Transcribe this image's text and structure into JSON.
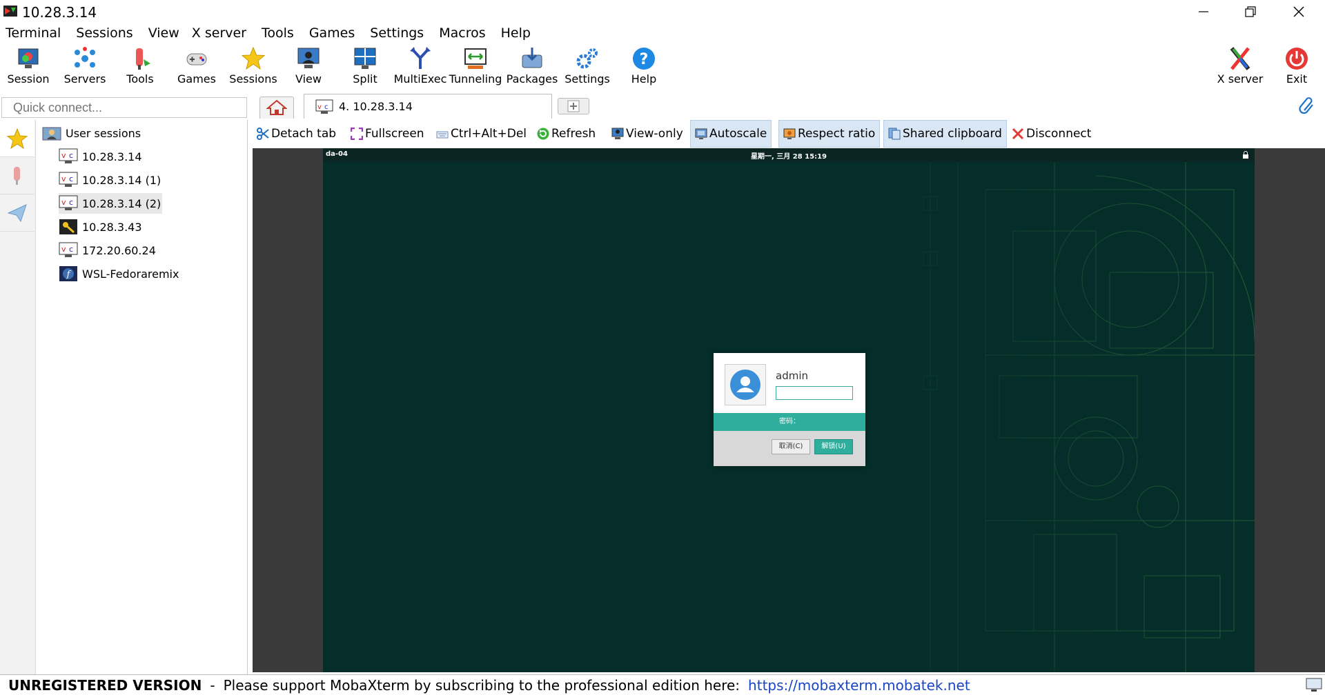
{
  "window": {
    "title": "10.28.3.14"
  },
  "menu": [
    "Terminal",
    "Sessions",
    "View",
    "X server",
    "Tools",
    "Games",
    "Settings",
    "Macros",
    "Help"
  ],
  "toolbar": {
    "left": [
      {
        "label": "Session",
        "icon": "session-icon"
      },
      {
        "label": "Servers",
        "icon": "servers-icon"
      },
      {
        "label": "Tools",
        "icon": "tools-icon"
      },
      {
        "label": "Games",
        "icon": "games-icon"
      },
      {
        "label": "Sessions",
        "icon": "star-icon"
      },
      {
        "label": "View",
        "icon": "view-icon"
      },
      {
        "label": "Split",
        "icon": "split-icon"
      },
      {
        "label": "MultiExec",
        "icon": "multiexec-icon"
      },
      {
        "label": "Tunneling",
        "icon": "tunneling-icon"
      },
      {
        "label": "Packages",
        "icon": "packages-icon"
      },
      {
        "label": "Settings",
        "icon": "settings-icon"
      },
      {
        "label": "Help",
        "icon": "help-icon"
      }
    ],
    "right": [
      {
        "label": "X server",
        "icon": "x-server-icon"
      },
      {
        "label": "Exit",
        "icon": "exit-icon"
      }
    ]
  },
  "quick_connect": {
    "placeholder": "Quick connect..."
  },
  "tabs": {
    "active_label": "4. 10.28.3.14"
  },
  "sessions": {
    "root": "User sessions",
    "items": [
      {
        "label": "10.28.3.14",
        "type": "vnc"
      },
      {
        "label": "10.28.3.14 (1)",
        "type": "vnc"
      },
      {
        "label": "10.28.3.14 (2)",
        "type": "vnc",
        "selected": true
      },
      {
        "label": "10.28.3.43",
        "type": "ssh"
      },
      {
        "label": "172.20.60.24",
        "type": "vnc"
      },
      {
        "label": "WSL-Fedoraremix",
        "type": "wsl"
      }
    ]
  },
  "vnc_toolbar": [
    {
      "label": "Detach tab",
      "icon": "scissors-icon"
    },
    {
      "label": "Fullscreen",
      "icon": "fullscreen-icon"
    },
    {
      "label": "Ctrl+Alt+Del",
      "icon": "keyboard-icon"
    },
    {
      "label": "Refresh",
      "icon": "refresh-icon"
    },
    {
      "label": "View-only",
      "icon": "view-only-icon"
    },
    {
      "label": "Autoscale",
      "icon": "autoscale-icon",
      "active": true
    },
    {
      "label": "Respect ratio",
      "icon": "ratio-icon",
      "active": true
    },
    {
      "label": "Shared clipboard",
      "icon": "clipboard-icon",
      "active": true
    },
    {
      "label": "Disconnect",
      "icon": "disconnect-icon"
    }
  ],
  "remote": {
    "hostname": "da-04",
    "datetime": "星期一, 三月 28   15:19",
    "login": {
      "user": "admin",
      "password_label": "密码：",
      "cancel": "取消(C)",
      "unlock": "解锁(U)"
    }
  },
  "status": {
    "unregistered": "UNREGISTERED VERSION",
    "sep": "-",
    "message": "Please support MobaXterm by subscribing to the professional edition here:",
    "link": "https://mobaxterm.mobatek.net"
  },
  "colors": {
    "accent": "#2fae9d",
    "screen_bg": "#052e2a",
    "link": "#1a44c6",
    "active_btn": "#d9e6f4"
  }
}
